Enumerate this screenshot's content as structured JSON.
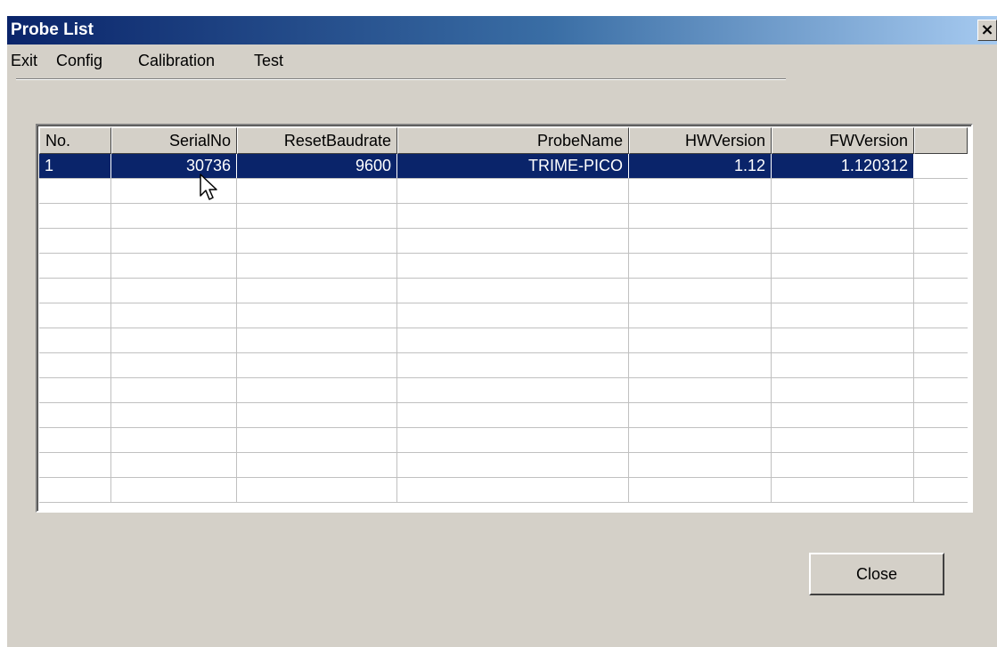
{
  "window": {
    "title": "Probe List",
    "close_glyph": "×"
  },
  "menu": {
    "items": [
      "Exit",
      "Config",
      "Calibration",
      "Test"
    ]
  },
  "table": {
    "columns": [
      "No.",
      "SerialNo",
      "ResetBaudrate",
      "ProbeName",
      "HWVersion",
      "FWVersion"
    ],
    "rows": [
      {
        "no": "1",
        "serial": "30736",
        "baud": "9600",
        "name": "TRIME-PICO",
        "hw": "1.12",
        "fw": "1.120312",
        "selected": true
      }
    ]
  },
  "buttons": {
    "close_label": "Close"
  },
  "colors": {
    "selection": "#0a246a",
    "dialog_face": "#d4d0c8"
  },
  "icons": {
    "cursor": "mouse-pointer-icon"
  }
}
